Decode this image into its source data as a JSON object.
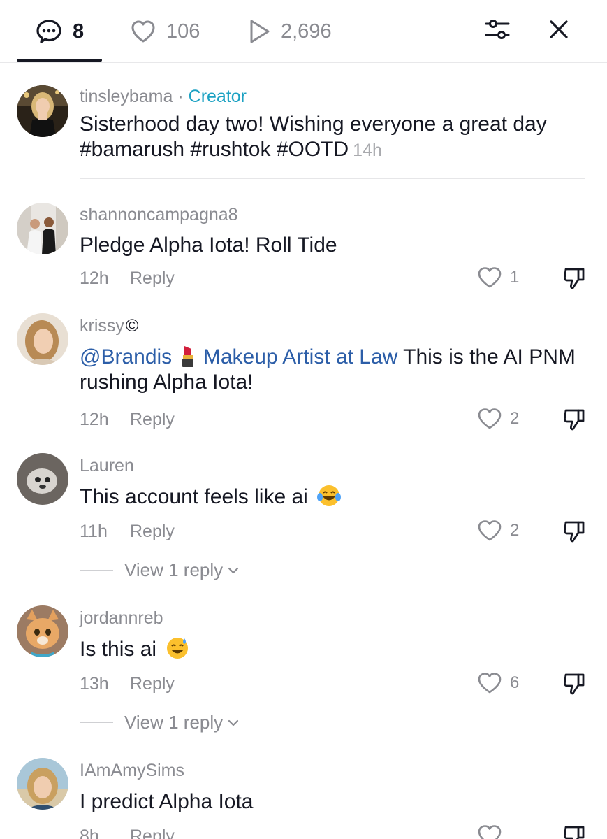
{
  "tabs": {
    "comments_count": "8",
    "likes_count": "106",
    "views_count": "2,696"
  },
  "creator_post": {
    "username": "tinsleybama",
    "separator": "·",
    "creator_label": "Creator",
    "text": "Sisterhood day two! Wishing everyone a great day #bamarush #rushtok #OOTD",
    "time": "14h"
  },
  "comments": [
    {
      "username": "shannoncampagna8",
      "text": "Pledge Alpha Iota! Roll Tide",
      "time": "12h",
      "reply_label": "Reply",
      "likes": "1"
    },
    {
      "username": "krissy",
      "username_badge": "©",
      "mention_a": "@Brandis",
      "mention_b": "Makeup Artist at Law",
      "text": " This is the AI PNM rushing Alpha Iota!",
      "time": "12h",
      "reply_label": "Reply",
      "likes": "2"
    },
    {
      "username": "Lauren",
      "text": "This account feels like ai",
      "time": "11h",
      "reply_label": "Reply",
      "likes": "2",
      "view_replies": "View 1 reply"
    },
    {
      "username": "jordannreb",
      "text": "Is this ai",
      "time": "13h",
      "reply_label": "Reply",
      "likes": "6",
      "view_replies": "View 1 reply"
    },
    {
      "username": "IAmAmySims",
      "text": "I predict Alpha Iota",
      "time": "8h",
      "reply_label": "Reply"
    }
  ],
  "colors": {
    "creator_accent": "#1da2c3",
    "mention": "#2c5ea8",
    "muted_text": "#8a8b91",
    "primary_text": "#161823"
  }
}
